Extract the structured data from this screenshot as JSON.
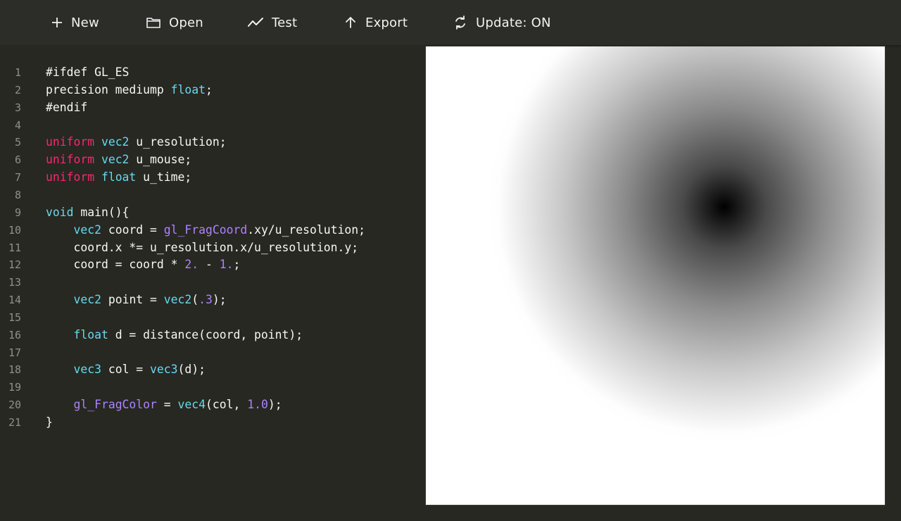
{
  "toolbar": {
    "items": [
      {
        "label": "New",
        "icon": "plus-icon"
      },
      {
        "label": "Open",
        "icon": "folder-icon"
      },
      {
        "label": "Test",
        "icon": "chart-line-icon"
      },
      {
        "label": "Export",
        "icon": "arrow-up-icon"
      },
      {
        "label": "Update: ON",
        "icon": "refresh-icon"
      }
    ]
  },
  "colors": {
    "background": "#272822",
    "keyword_pink": "#f92672",
    "type_cyan": "#66d9ef",
    "number_purple": "#ae81ff",
    "text": "#f8f8f2",
    "line_number": "#8f908a"
  },
  "editor": {
    "lines": [
      {
        "n": "1",
        "tokens": [
          {
            "t": "#ifdef GL_ES",
            "c": "plain"
          }
        ]
      },
      {
        "n": "2",
        "tokens": [
          {
            "t": "precision mediump ",
            "c": "plain"
          },
          {
            "t": "float",
            "c": "cyan"
          },
          {
            "t": ";",
            "c": "plain"
          }
        ]
      },
      {
        "n": "3",
        "tokens": [
          {
            "t": "#endif",
            "c": "plain"
          }
        ]
      },
      {
        "n": "4",
        "tokens": []
      },
      {
        "n": "5",
        "tokens": [
          {
            "t": "uniform",
            "c": "pink"
          },
          {
            "t": " ",
            "c": "plain"
          },
          {
            "t": "vec2",
            "c": "cyan"
          },
          {
            "t": " u_resolution;",
            "c": "plain"
          }
        ]
      },
      {
        "n": "6",
        "tokens": [
          {
            "t": "uniform",
            "c": "pink"
          },
          {
            "t": " ",
            "c": "plain"
          },
          {
            "t": "vec2",
            "c": "cyan"
          },
          {
            "t": " u_mouse;",
            "c": "plain"
          }
        ]
      },
      {
        "n": "7",
        "tokens": [
          {
            "t": "uniform",
            "c": "pink"
          },
          {
            "t": " ",
            "c": "plain"
          },
          {
            "t": "float",
            "c": "cyan"
          },
          {
            "t": " u_time;",
            "c": "plain"
          }
        ]
      },
      {
        "n": "8",
        "tokens": []
      },
      {
        "n": "9",
        "tokens": [
          {
            "t": "void",
            "c": "cyan"
          },
          {
            "t": " main(){",
            "c": "plain"
          }
        ]
      },
      {
        "n": "10",
        "tokens": [
          {
            "t": "    ",
            "c": "plain"
          },
          {
            "t": "vec2",
            "c": "cyan"
          },
          {
            "t": " coord = ",
            "c": "plain"
          },
          {
            "t": "gl_FragCoord",
            "c": "purple"
          },
          {
            "t": ".xy/u_resolution;",
            "c": "plain"
          }
        ]
      },
      {
        "n": "11",
        "tokens": [
          {
            "t": "    coord.x *= u_resolution.x/u_resolution.y;",
            "c": "plain"
          }
        ]
      },
      {
        "n": "12",
        "tokens": [
          {
            "t": "    coord = coord * ",
            "c": "plain"
          },
          {
            "t": "2.",
            "c": "purple"
          },
          {
            "t": " - ",
            "c": "plain"
          },
          {
            "t": "1.",
            "c": "purple"
          },
          {
            "t": ";",
            "c": "plain"
          }
        ]
      },
      {
        "n": "13",
        "tokens": []
      },
      {
        "n": "14",
        "tokens": [
          {
            "t": "    ",
            "c": "plain"
          },
          {
            "t": "vec2",
            "c": "cyan"
          },
          {
            "t": " point = ",
            "c": "plain"
          },
          {
            "t": "vec2",
            "c": "cyan"
          },
          {
            "t": "(",
            "c": "plain"
          },
          {
            "t": ".3",
            "c": "purple"
          },
          {
            "t": ");",
            "c": "plain"
          }
        ]
      },
      {
        "n": "15",
        "tokens": []
      },
      {
        "n": "16",
        "tokens": [
          {
            "t": "    ",
            "c": "plain"
          },
          {
            "t": "float",
            "c": "cyan"
          },
          {
            "t": " d = distance(coord, point);",
            "c": "plain"
          }
        ]
      },
      {
        "n": "17",
        "tokens": []
      },
      {
        "n": "18",
        "tokens": [
          {
            "t": "    ",
            "c": "plain"
          },
          {
            "t": "vec3",
            "c": "cyan"
          },
          {
            "t": " col = ",
            "c": "plain"
          },
          {
            "t": "vec3",
            "c": "cyan"
          },
          {
            "t": "(d);",
            "c": "plain"
          }
        ]
      },
      {
        "n": "19",
        "tokens": []
      },
      {
        "n": "20",
        "tokens": [
          {
            "t": "    ",
            "c": "plain"
          },
          {
            "t": "gl_FragColor",
            "c": "purple"
          },
          {
            "t": " = ",
            "c": "plain"
          },
          {
            "t": "vec4",
            "c": "cyan"
          },
          {
            "t": "(col, ",
            "c": "plain"
          },
          {
            "t": "1.0",
            "c": "purple"
          },
          {
            "t": ");",
            "c": "plain"
          }
        ]
      },
      {
        "n": "21",
        "tokens": [
          {
            "t": "}",
            "c": "plain"
          }
        ]
      }
    ]
  }
}
